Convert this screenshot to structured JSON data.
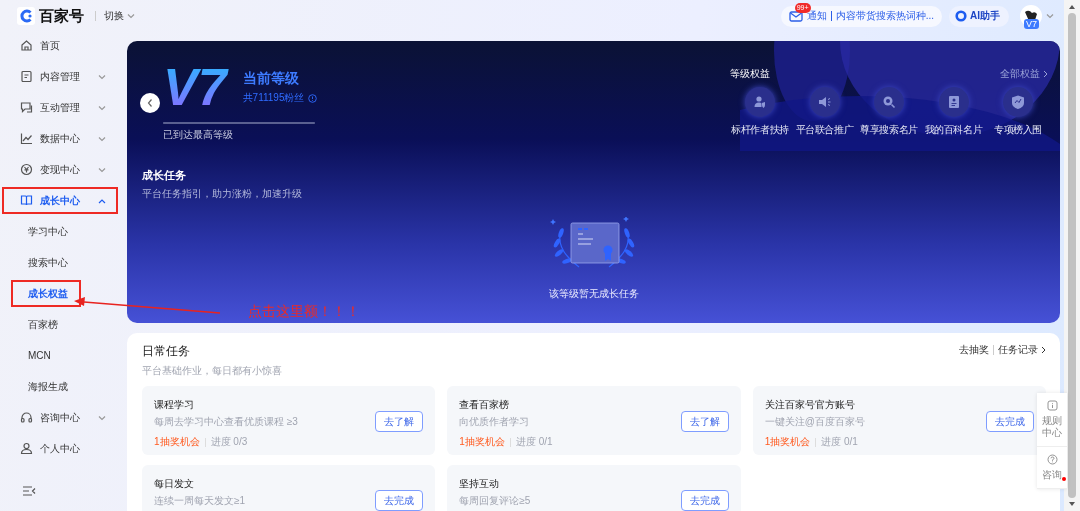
{
  "header": {
    "logo": "百家号",
    "switch": "切换",
    "notification": {
      "badge": "99+",
      "label": "通知",
      "message": "内容带货搜索热词种..."
    },
    "assistant": "AI助手",
    "avatar_badge": "V7"
  },
  "sidebar": {
    "items": [
      {
        "label": "首页",
        "selected": false,
        "annotated": false
      },
      {
        "label": "内容管理",
        "selected": false,
        "expanded": false,
        "annotated": false
      },
      {
        "label": "互动管理",
        "selected": false,
        "expanded": false,
        "annotated": false
      },
      {
        "label": "数据中心",
        "selected": false,
        "expanded": false,
        "annotated": false
      },
      {
        "label": "变现中心",
        "selected": false,
        "expanded": false,
        "annotated": false
      },
      {
        "label": "成长中心",
        "selected": true,
        "expanded": true,
        "annotated": true,
        "children": [
          {
            "label": "学习中心",
            "selected": false,
            "annotated": false
          },
          {
            "label": "搜索中心",
            "selected": false,
            "annotated": false
          },
          {
            "label": "成长权益",
            "selected": true,
            "annotated": true
          },
          {
            "label": "百家榜",
            "selected": false,
            "annotated": false
          },
          {
            "label": "MCN",
            "selected": false,
            "annotated": false
          },
          {
            "label": "海报生成",
            "selected": false,
            "annotated": false
          }
        ]
      },
      {
        "label": "咨询中心",
        "selected": false,
        "expanded": false,
        "annotated": false
      },
      {
        "label": "个人中心",
        "selected": false,
        "annotated": false
      }
    ]
  },
  "level_card": {
    "level": "V7",
    "level_label": "当前等级",
    "fans": "共711195粉丝",
    "progress": {
      "level": 1
    },
    "progress_text": "已到达最高等级",
    "benefits_title": "等级权益",
    "all_benefits": "全部权益",
    "benefits": [
      "标杆作者扶持",
      "平台联合推广",
      "尊享搜索名片",
      "我的百科名片",
      "专项榜入围"
    ],
    "growth_title": "成长任务",
    "growth_subtitle": "平台任务指引，助力涨粉，加速升级",
    "empty_text": "该等级暂无成长任务"
  },
  "daily_tasks": {
    "title": "日常任务",
    "subtitle": "平台基础作业，每日都有小惊喜",
    "links": [
      "去抽奖",
      "任务记录"
    ],
    "tasks": [
      {
        "title": "课程学习",
        "description": "每周去学习中心查看优质课程 ≥3",
        "reward": "1抽奖机会",
        "progress": "进度 0/3",
        "button": "去了解"
      },
      {
        "title": "查看百家榜",
        "description": "向优质作者学习",
        "reward": "1抽奖机会",
        "progress": "进度 0/1",
        "button": "去了解"
      },
      {
        "title": "关注百家号官方账号",
        "description": "一键关注@百度百家号",
        "reward": "1抽奖机会",
        "progress": "进度 0/1",
        "button": "去完成"
      },
      {
        "title": "每日发文",
        "description": "连续一周每天发文≥1",
        "button": "去完成"
      },
      {
        "title": "坚持互动",
        "description": "每周回复评论≥5",
        "button": "去完成"
      }
    ]
  },
  "float_panel": [
    {
      "label": "规则中心",
      "dot": false
    },
    {
      "label": "咨询",
      "dot": true
    }
  ],
  "annotation": {
    "text": "点击这里额！！！"
  }
}
